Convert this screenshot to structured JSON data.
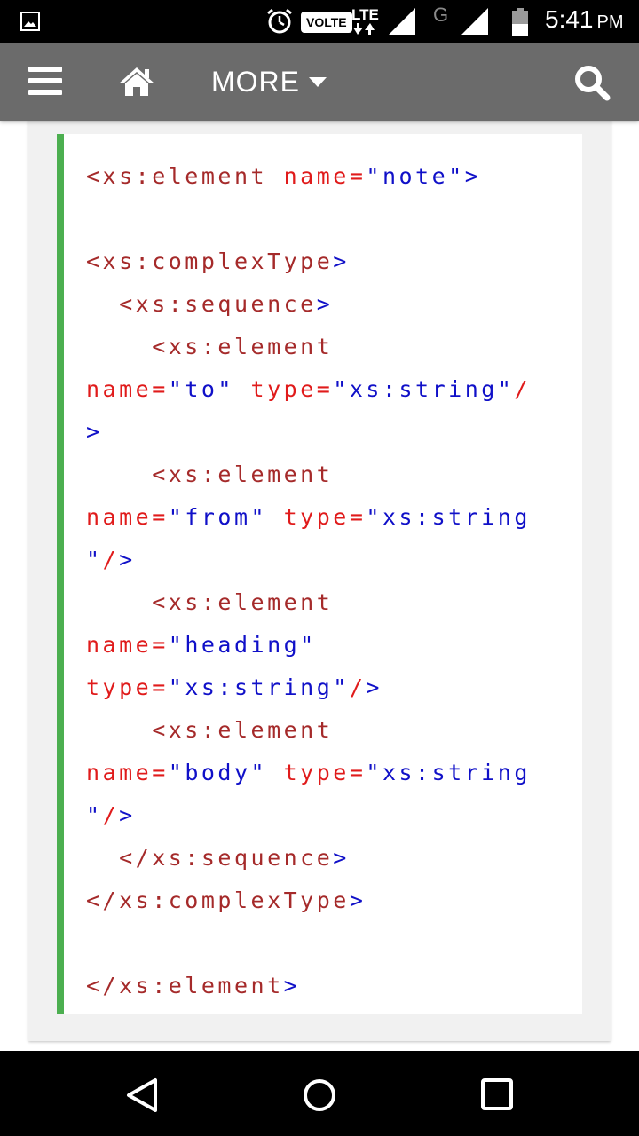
{
  "status_bar": {
    "volte_label": "VOLTE",
    "lte_label": "LTE",
    "network_label": "G",
    "time": "5:41",
    "ampm": "PM",
    "icons": [
      "image-icon",
      "alarm-icon",
      "signal-icon",
      "battery-icon"
    ]
  },
  "toolbar": {
    "more_label": "MORE",
    "icons": [
      "menu-icon",
      "home-icon",
      "caret-down-icon",
      "search-icon"
    ],
    "background": "#6b6b6b"
  },
  "code_block": {
    "accent_color": "#4caf50",
    "colors": {
      "tag": "#a52a2a",
      "attribute": "#e01b1b",
      "value": "#1010c8"
    },
    "lines": [
      [
        {
          "t": "<xs:element ",
          "k": "tag"
        },
        {
          "t": "name=",
          "k": "attr"
        },
        {
          "t": "\"note\"",
          "k": "val"
        },
        {
          "t": ">",
          "k": "brk"
        }
      ],
      [],
      [
        {
          "t": "<xs:complexType",
          "k": "tag"
        },
        {
          "t": ">",
          "k": "brk"
        }
      ],
      [
        {
          "t": "  <xs:sequence",
          "k": "tag"
        },
        {
          "t": ">",
          "k": "brk"
        }
      ],
      [
        {
          "t": "    <xs:element",
          "k": "tag"
        }
      ],
      [
        {
          "t": "name=",
          "k": "attr"
        },
        {
          "t": "\"to\"",
          "k": "val"
        },
        {
          "t": " type=",
          "k": "attr"
        },
        {
          "t": "\"xs:string\"",
          "k": "val"
        },
        {
          "t": "/",
          "k": "attr"
        }
      ],
      [
        {
          "t": ">",
          "k": "brk"
        }
      ],
      [
        {
          "t": "    <xs:element",
          "k": "tag"
        }
      ],
      [
        {
          "t": "name=",
          "k": "attr"
        },
        {
          "t": "\"from\"",
          "k": "val"
        },
        {
          "t": " type=",
          "k": "attr"
        },
        {
          "t": "\"xs:string",
          "k": "val"
        }
      ],
      [
        {
          "t": "\"",
          "k": "val"
        },
        {
          "t": "/",
          "k": "attr"
        },
        {
          "t": ">",
          "k": "brk"
        }
      ],
      [
        {
          "t": "    <xs:element",
          "k": "tag"
        }
      ],
      [
        {
          "t": "name=",
          "k": "attr"
        },
        {
          "t": "\"heading\"",
          "k": "val"
        }
      ],
      [
        {
          "t": "type=",
          "k": "attr"
        },
        {
          "t": "\"xs:string\"",
          "k": "val"
        },
        {
          "t": "/",
          "k": "attr"
        },
        {
          "t": ">",
          "k": "brk"
        }
      ],
      [
        {
          "t": "    <xs:element",
          "k": "tag"
        }
      ],
      [
        {
          "t": "name=",
          "k": "attr"
        },
        {
          "t": "\"body\"",
          "k": "val"
        },
        {
          "t": " type=",
          "k": "attr"
        },
        {
          "t": "\"xs:string",
          "k": "val"
        }
      ],
      [
        {
          "t": "\"",
          "k": "val"
        },
        {
          "t": "/",
          "k": "attr"
        },
        {
          "t": ">",
          "k": "brk"
        }
      ],
      [
        {
          "t": "  </xs:sequence",
          "k": "tag"
        },
        {
          "t": ">",
          "k": "brk"
        }
      ],
      [
        {
          "t": "</xs:complexType",
          "k": "tag"
        },
        {
          "t": ">",
          "k": "brk"
        }
      ],
      [],
      [
        {
          "t": "</xs:element",
          "k": "tag"
        },
        {
          "t": ">",
          "k": "brk"
        }
      ]
    ]
  },
  "nav_bar": {
    "icons": [
      "back-icon",
      "home-circle-icon",
      "recents-icon"
    ]
  }
}
